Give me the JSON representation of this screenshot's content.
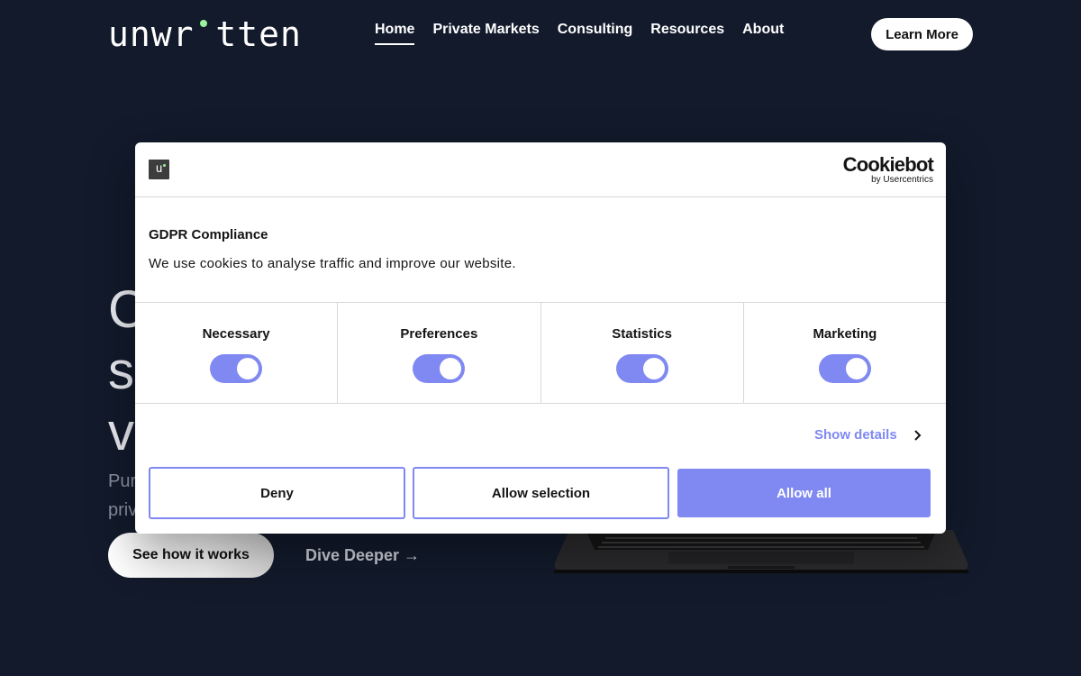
{
  "header": {
    "logo_text": "unwr tten",
    "nav": [
      {
        "label": "Home",
        "active": true
      },
      {
        "label": "Private Markets"
      },
      {
        "label": "Consulting"
      },
      {
        "label": "Resources"
      },
      {
        "label": "About"
      }
    ],
    "cta_label": "Learn More"
  },
  "hero": {
    "lines": [
      "C",
      "s",
      "v"
    ],
    "subtitle_lines": [
      "Pur",
      "priv"
    ],
    "primary_cta": "See how it works",
    "secondary_cta": "Dive Deeper →"
  },
  "cookie_dialog": {
    "brand_badge": "u",
    "provider_name": "Cookiebot",
    "provider_byline": "by Usercentrics",
    "title": "GDPR Compliance",
    "message": "We use cookies to analyse traffic and improve our website.",
    "categories": [
      {
        "label": "Necessary",
        "enabled": true
      },
      {
        "label": "Preferences",
        "enabled": true
      },
      {
        "label": "Statistics",
        "enabled": true
      },
      {
        "label": "Marketing",
        "enabled": true
      }
    ],
    "show_details_label": "Show details",
    "buttons": {
      "deny": "Deny",
      "allow_selection": "Allow selection",
      "allow_all": "Allow all"
    }
  },
  "colors": {
    "background": "#121a2b",
    "accent": "#7f89f1",
    "logo_dot": "#9af29a"
  }
}
